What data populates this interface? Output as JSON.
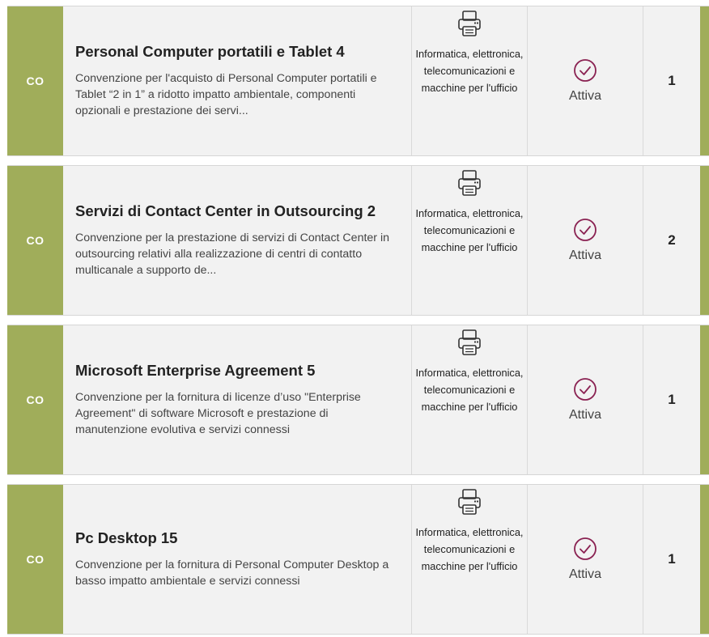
{
  "accent_color": "#a0ad5a",
  "status_color": "#8a2252",
  "items": [
    {
      "type_code": "CO",
      "title": "Personal Computer portatili e Tablet 4",
      "description": "Convenzione per l'acquisto di Personal Computer portatili e Tablet “2 in 1” a ridotto impatto ambientale, componenti opzionali e prestazione dei servi...",
      "category_icon": "printer-icon",
      "category": "Informatica, elettronica, telecomunicazioni e macchine per l'ufficio",
      "status_icon": "check-circle-icon",
      "status": "Attiva",
      "count": "1"
    },
    {
      "type_code": "CO",
      "title": "Servizi di Contact Center in Outsourcing 2",
      "description": "Convenzione per la prestazione di servizi di Contact Center in outsourcing relativi alla realizzazione di centri di contatto multicanale a supporto de...",
      "category_icon": "printer-icon",
      "category": "Informatica, elettronica, telecomunicazioni e macchine per l'ufficio",
      "status_icon": "check-circle-icon",
      "status": "Attiva",
      "count": "2"
    },
    {
      "type_code": "CO",
      "title": "Microsoft Enterprise Agreement 5",
      "description": "Convenzione per la fornitura di licenze d’uso \"Enterprise Agreement\" di software Microsoft e prestazione di manutenzione evolutiva e servizi connessi",
      "category_icon": "printer-icon",
      "category": "Informatica, elettronica, telecomunicazioni e macchine per l'ufficio",
      "status_icon": "check-circle-icon",
      "status": "Attiva",
      "count": "1"
    },
    {
      "type_code": "CO",
      "title": "Pc Desktop 15",
      "description": "Convenzione per la fornitura di Personal Computer Desktop a basso impatto ambientale e servizi connessi",
      "category_icon": "printer-icon",
      "category": "Informatica, elettronica, telecomunicazioni e macchine per l'ufficio",
      "status_icon": "check-circle-icon",
      "status": "Attiva",
      "count": "1"
    }
  ]
}
